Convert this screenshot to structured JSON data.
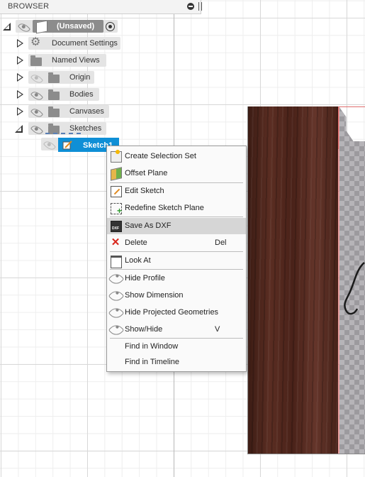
{
  "browser": {
    "title": "BROWSER",
    "root_label": "(Unsaved)",
    "items": [
      {
        "label": "Document Settings"
      },
      {
        "label": "Named Views"
      },
      {
        "label": "Origin"
      },
      {
        "label": "Bodies"
      },
      {
        "label": "Canvases"
      },
      {
        "label": "Sketches"
      }
    ],
    "selected_sketch": "Sketch1",
    "accent": "#0f8fd6"
  },
  "context_menu": {
    "items": [
      {
        "label": "Create Selection Set",
        "icon": "selection-set-icon"
      },
      {
        "label": "Offset Plane",
        "icon": "offset-plane-icon"
      },
      {
        "label": "Edit Sketch",
        "icon": "edit-sketch-icon"
      },
      {
        "label": "Redefine Sketch Plane",
        "icon": "redefine-plane-icon"
      },
      {
        "label": "Save As DXF",
        "icon": "dxf-icon",
        "highlighted": true
      },
      {
        "label": "Delete",
        "icon": "delete-icon",
        "shortcut": "Del"
      },
      {
        "label": "Look At",
        "icon": "look-at-icon"
      },
      {
        "label": "Hide Profile",
        "icon": "eye-icon"
      },
      {
        "label": "Show Dimension",
        "icon": "eye-icon"
      },
      {
        "label": "Hide Projected Geometries",
        "icon": "eye-icon"
      },
      {
        "label": "Show/Hide",
        "icon": "eye-icon",
        "shortcut": "V"
      },
      {
        "label": "Find in Window"
      },
      {
        "label": "Find in Timeline"
      }
    ]
  }
}
